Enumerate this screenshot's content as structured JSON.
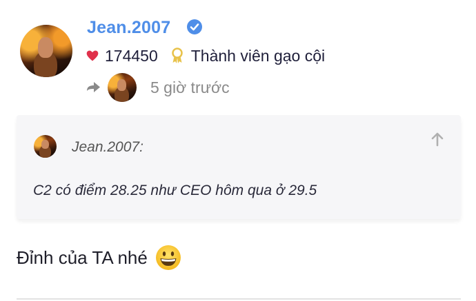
{
  "post": {
    "username": "Jean.2007",
    "likes": "174450",
    "rank": "Thành viên gạo cội",
    "time_ago": "5 giờ trước",
    "quote": {
      "author": "Jean.2007:",
      "text": "C2 có điểm 28.25 như CEO hôm qua ở 29.5"
    },
    "body": "Đỉnh của TA nhé"
  },
  "icons": {
    "verified": "verified-check-icon",
    "heart": "heart-icon",
    "badge": "award-badge-icon",
    "reply": "reply-arrow-icon",
    "expand": "arrow-up-icon",
    "emoji": "grinning-face-emoji"
  },
  "colors": {
    "username": "#4f8ee8",
    "verified": "#4f8ee8",
    "heart": "#e0314b",
    "badge": "#e8c24a",
    "quote_bg": "#f6f6f8"
  }
}
